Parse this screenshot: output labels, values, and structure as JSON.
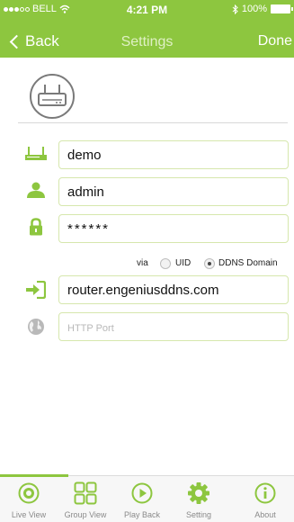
{
  "status_bar": {
    "carrier": "BELL",
    "time": "4:21 PM",
    "battery": "100%"
  },
  "nav": {
    "back_label": "Back",
    "title": "Settings",
    "done_label": "Done"
  },
  "form": {
    "name_value": "demo",
    "user_value": "admin",
    "password_value": "******",
    "via_label": "via",
    "via_options": [
      "UID",
      "DDNS Domain"
    ],
    "via_selected": "DDNS Domain",
    "address_value": "router.engeniusddns.com",
    "port_placeholder": "HTTP Port",
    "port_value": ""
  },
  "tabs": [
    {
      "label": "Live View",
      "icon": "live-view-icon",
      "active": true
    },
    {
      "label": "Group View",
      "icon": "group-view-icon",
      "active": false
    },
    {
      "label": "Play Back",
      "icon": "play-back-icon",
      "active": false
    },
    {
      "label": "Setting",
      "icon": "setting-gear-icon",
      "active": false
    },
    {
      "label": "About",
      "icon": "about-info-icon",
      "active": false
    }
  ],
  "colors": {
    "accent": "#8dc63f",
    "field_border": "#d6e7ad",
    "icon_gray": "#7a7a7a"
  }
}
